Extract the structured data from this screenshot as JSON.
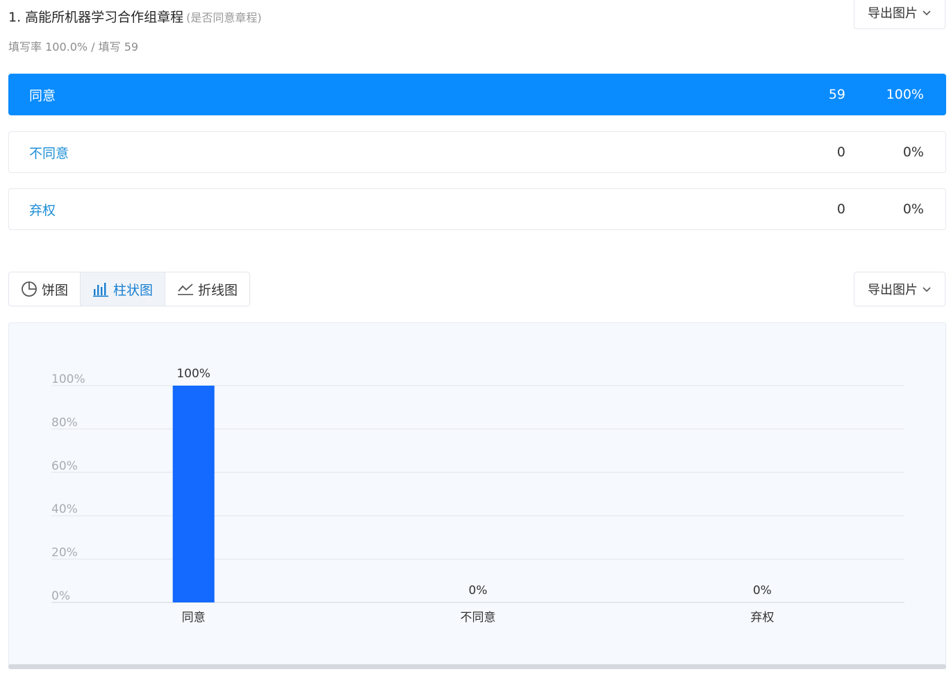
{
  "question": {
    "title": "1. 高能所机器学习合作组章程",
    "subtitle": "(是否同意章程)",
    "stats": "填写率 100.0% / 填写 59"
  },
  "export_label": "导出图片",
  "options": [
    {
      "label": "同意",
      "count": "59",
      "percent": "100%",
      "active": true
    },
    {
      "label": "不同意",
      "count": "0",
      "percent": "0%",
      "active": false
    },
    {
      "label": "弃权",
      "count": "0",
      "percent": "0%",
      "active": false
    }
  ],
  "chart_tabs": [
    {
      "label": "饼图",
      "icon": "pie-chart-icon",
      "active": false
    },
    {
      "label": "柱状图",
      "icon": "bar-chart-icon",
      "active": true
    },
    {
      "label": "折线图",
      "icon": "line-chart-icon",
      "active": false
    }
  ],
  "colors": {
    "accent": "#0a8cff",
    "bar": "#1469ff",
    "option_text": "#1e8fd6",
    "tab_active": "#1a7fd0"
  },
  "chart_data": {
    "type": "bar",
    "categories": [
      "同意",
      "不同意",
      "弃权"
    ],
    "values": [
      100,
      0,
      0
    ],
    "data_labels": [
      "100%",
      "0%",
      "0%"
    ],
    "yticks": [
      "0%",
      "20%",
      "40%",
      "60%",
      "80%",
      "100%"
    ],
    "ylim": [
      0,
      100
    ],
    "grid": true
  }
}
